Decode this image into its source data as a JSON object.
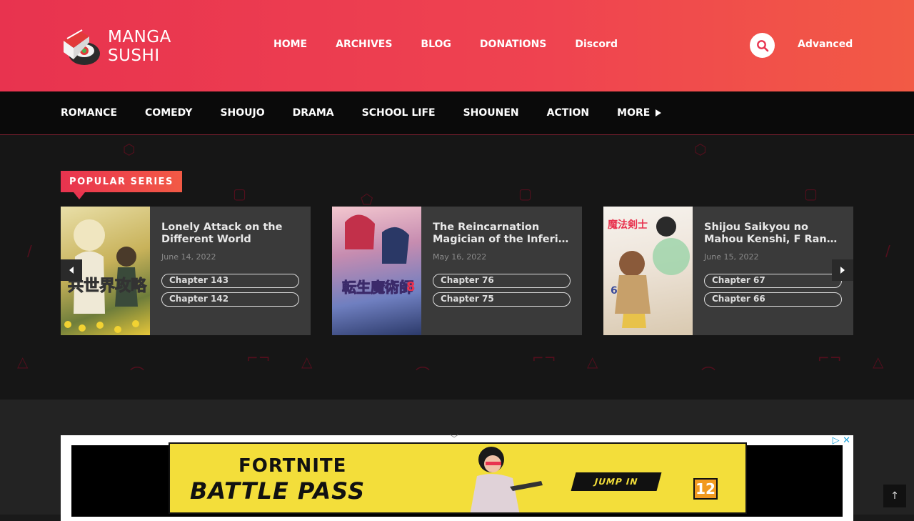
{
  "site": {
    "logo_text": "MANGA SUSHI",
    "brand_colors": {
      "primary": "#e8334f",
      "secondary": "#f25a45",
      "dark": "#0a0a0a"
    }
  },
  "nav": {
    "items": [
      {
        "label": "HOME"
      },
      {
        "label": "ARCHIVES"
      },
      {
        "label": "BLOG"
      },
      {
        "label": "DONATIONS"
      },
      {
        "label": "Discord"
      }
    ],
    "search_icon": "search-icon",
    "advanced_label": "Advanced"
  },
  "genres": {
    "items": [
      {
        "label": "ROMANCE"
      },
      {
        "label": "COMEDY"
      },
      {
        "label": "SHOUJO"
      },
      {
        "label": "DRAMA"
      },
      {
        "label": "SCHOOL LIFE"
      },
      {
        "label": "SHOUNEN"
      },
      {
        "label": "ACTION"
      },
      {
        "label": "MORE"
      }
    ]
  },
  "popular": {
    "heading": "POPULAR SERIES",
    "cards": [
      {
        "title": "Lonely Attack on the Different World",
        "date": "June 14, 2022",
        "chapters": [
          "Chapter 143",
          "Chapter 142"
        ],
        "cover_color": "#d9c36a"
      },
      {
        "title": "The Reincarnation Magician of the Inferior Eyes",
        "date": "May 16, 2022",
        "chapters": [
          "Chapter 76",
          "Chapter 75"
        ],
        "cover_color": "#8fa4d6"
      },
      {
        "title": "Shijou Saikyou no Mahou Kenshi, F Rank Boukensha ni Tensei Suru",
        "date": "June 15, 2022",
        "chapters": [
          "Chapter 67",
          "Chapter 66"
        ],
        "cover_color": "#e8b26a"
      }
    ]
  },
  "ad": {
    "title1": "FORTNITE",
    "title2": "BATTLE PASS",
    "cta": "JUMP IN",
    "rating": "12"
  }
}
